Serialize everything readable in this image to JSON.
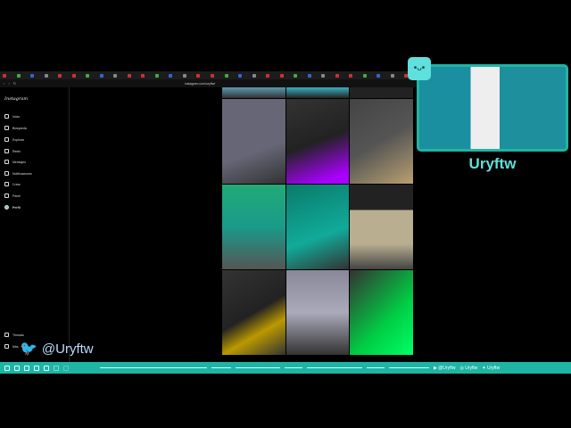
{
  "browser": {
    "url": "instagram.com/uryftw/",
    "tab_count": 30
  },
  "instagram": {
    "logo": "Instagram",
    "nav": [
      {
        "label": "Inicio",
        "icon": "home-icon"
      },
      {
        "label": "Búsqueda",
        "icon": "search-icon"
      },
      {
        "label": "Explorar",
        "icon": "compass-icon"
      },
      {
        "label": "Reels",
        "icon": "reels-icon"
      },
      {
        "label": "Mensajes",
        "icon": "messenger-icon"
      },
      {
        "label": "Notificaciones",
        "icon": "heart-icon"
      },
      {
        "label": "Crear",
        "icon": "plus-icon"
      },
      {
        "label": "Panel",
        "icon": "dashboard-icon"
      },
      {
        "label": "Perfil",
        "icon": "avatar-icon"
      }
    ],
    "bottom": [
      {
        "label": "Threads"
      },
      {
        "label": "Más"
      }
    ]
  },
  "stream": {
    "name": "Uryftw",
    "twitter": "@Uryftw",
    "socials": [
      "@Uryftw",
      "Uryftw",
      "Uryftw"
    ],
    "accent": "#1fb5a5"
  }
}
